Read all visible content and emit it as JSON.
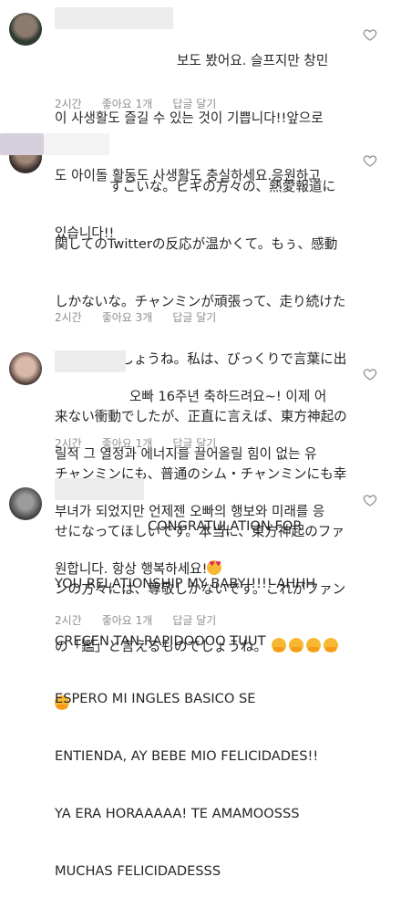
{
  "comments": [
    {
      "lines": [
        "보도 봤어요. 슬프지만 창민",
        "이 사생활도 즐길 수 있는 것이 기쁩니다!!앞으로",
        "도 아이돌 활동도 사생활도 충실하세요.응원하고",
        "있습니다!!"
      ],
      "time": "2시간",
      "likes": "좋아요 1개",
      "reply": "답글 달기",
      "heart_icon": "heart-outline-icon"
    },
    {
      "lines": [
        "すごいな。ビギの方々の、熱愛報道に",
        "関してのTwitterの反応が温かくて。もぅ、感動",
        "しかないな。チャンミンが頑張って、走り続けた",
        "からなんでしょうね。私は、びっくりで言葉に出",
        "来ない衝動でしたが、正直に言えば、東方神起の",
        "チャンミンにも、普通のシム・チャンミンにも幸",
        "せになってほしいです。本当に、東方神起のファ",
        "ンの方々には、尊敬しかないです。これがファン",
        "の「鑑」と言えるものでしょうね。"
      ],
      "emoji_count_line9": 4,
      "emoji_count_line10": 1,
      "time": "2시간",
      "likes": "좋아요 3개",
      "reply": "답글 달기",
      "heart_icon": "heart-outline-icon"
    },
    {
      "lines": [
        "오빠 16주년 축하드려요~! 이제 어",
        "릴적 그 열정과 에너지를 끌어올릴 힘이 없는 유",
        "부녀가 되었지만 언제젠 오빠의 행보와 미래를 응",
        "원합니다. 항상 행복하세요!"
      ],
      "time": "2시간",
      "likes": "좋아요 1개",
      "reply": "답글 달기",
      "heart_icon": "heart-outline-icon"
    },
    {
      "lines": [
        "CONGRATULATION FOR",
        "YOU RELATIONSHIP MY BABY!!!!! AHHH",
        "CRECEN TAN RAPIDOOOO TUUT",
        "ESPERO MI INGLES BASICO SE",
        "ENTIENDA, AY BEBE MIO FELICIDADES!!",
        "YA ERA HORAAAAA! TE AMAMOOSSS",
        "MUCHAS FELICIDADESSS"
      ],
      "time": "2시간",
      "likes": "좋아요 1개",
      "reply": "답글 달기",
      "heart_icon": "heart-outline-icon"
    }
  ],
  "colors": {
    "text": "#262626",
    "meta": "#8e8e8e",
    "heart_outline": "#8e8e8e",
    "blur": "#ececec"
  }
}
